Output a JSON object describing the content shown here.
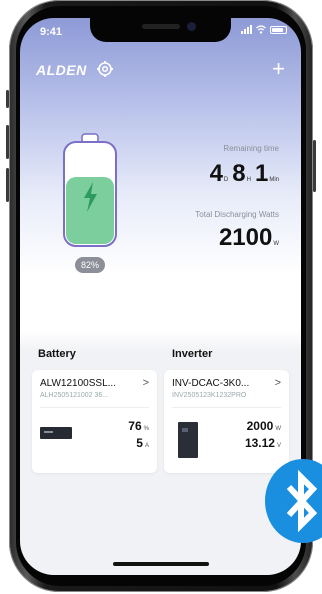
{
  "status_bar": {
    "time": "9:41"
  },
  "header": {
    "logo": "ALDEN"
  },
  "battery": {
    "percent_label": "82%",
    "charge_fraction": 0.82
  },
  "remaining": {
    "label": "Remaining time",
    "d": "4",
    "d_unit": "D",
    "h": "8",
    "h_unit": "H",
    "m": "1",
    "m_unit": "Min"
  },
  "discharging": {
    "label": "Total Discharging Watts",
    "value": "2100",
    "unit": "W"
  },
  "sections": {
    "battery": "Battery",
    "inverter": "Inverter"
  },
  "battery_card": {
    "name": "ALW12100SSL...",
    "serial": "ALH2505121002 36...",
    "soc": "76",
    "soc_unit": "%",
    "current": "5",
    "current_unit": "A"
  },
  "inverter_card": {
    "name": "INV-DCAC-3K0...",
    "serial": "INV2505123K1232PRO",
    "power": "2000",
    "power_unit": "W",
    "voltage": "13.12",
    "voltage_unit": "V"
  },
  "colors": {
    "header_gradient_top": "#8d9ad6",
    "battery_fill": "#7ccf9c",
    "battery_outline": "#7b6fc6",
    "bluetooth": "#1a8fe0"
  },
  "icons": [
    "gear-icon",
    "plus-icon",
    "bolt-icon",
    "chevron-right-icon",
    "bluetooth-icon"
  ]
}
